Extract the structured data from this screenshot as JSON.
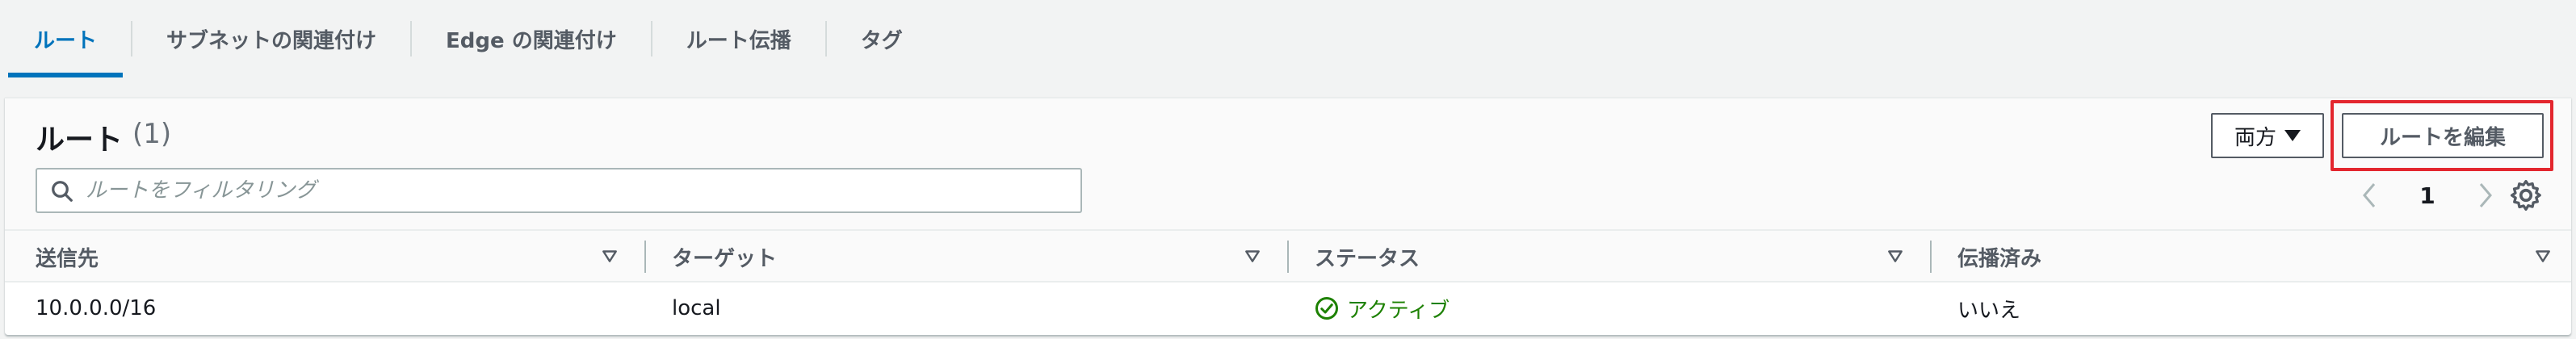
{
  "tabs": [
    {
      "label": "ルート",
      "active": true
    },
    {
      "label": "サブネットの関連付け",
      "active": false
    },
    {
      "label": "Edge の関連付け",
      "active": false
    },
    {
      "label": "ルート伝播",
      "active": false
    },
    {
      "label": "タグ",
      "active": false
    }
  ],
  "panel": {
    "title": "ルート",
    "count": "(1)",
    "filter_placeholder": "ルートをフィルタリング",
    "select_value": "両方",
    "edit_button": "ルートを編集",
    "page": "1"
  },
  "table": {
    "columns": [
      "送信先",
      "ターゲット",
      "ステータス",
      "伝播済み"
    ],
    "rows": [
      {
        "destination": "10.0.0.0/16",
        "target": "local",
        "status": "アクティブ",
        "propagated": "いいえ"
      }
    ]
  },
  "colors": {
    "accent": "#0073bb",
    "status_active": "#1d8102",
    "highlight": "#e3262e"
  },
  "icons": [
    "search-icon",
    "caret-down-icon",
    "chevron-left-icon",
    "chevron-right-icon",
    "gear-icon",
    "sort-icon",
    "check-circle-icon"
  ]
}
